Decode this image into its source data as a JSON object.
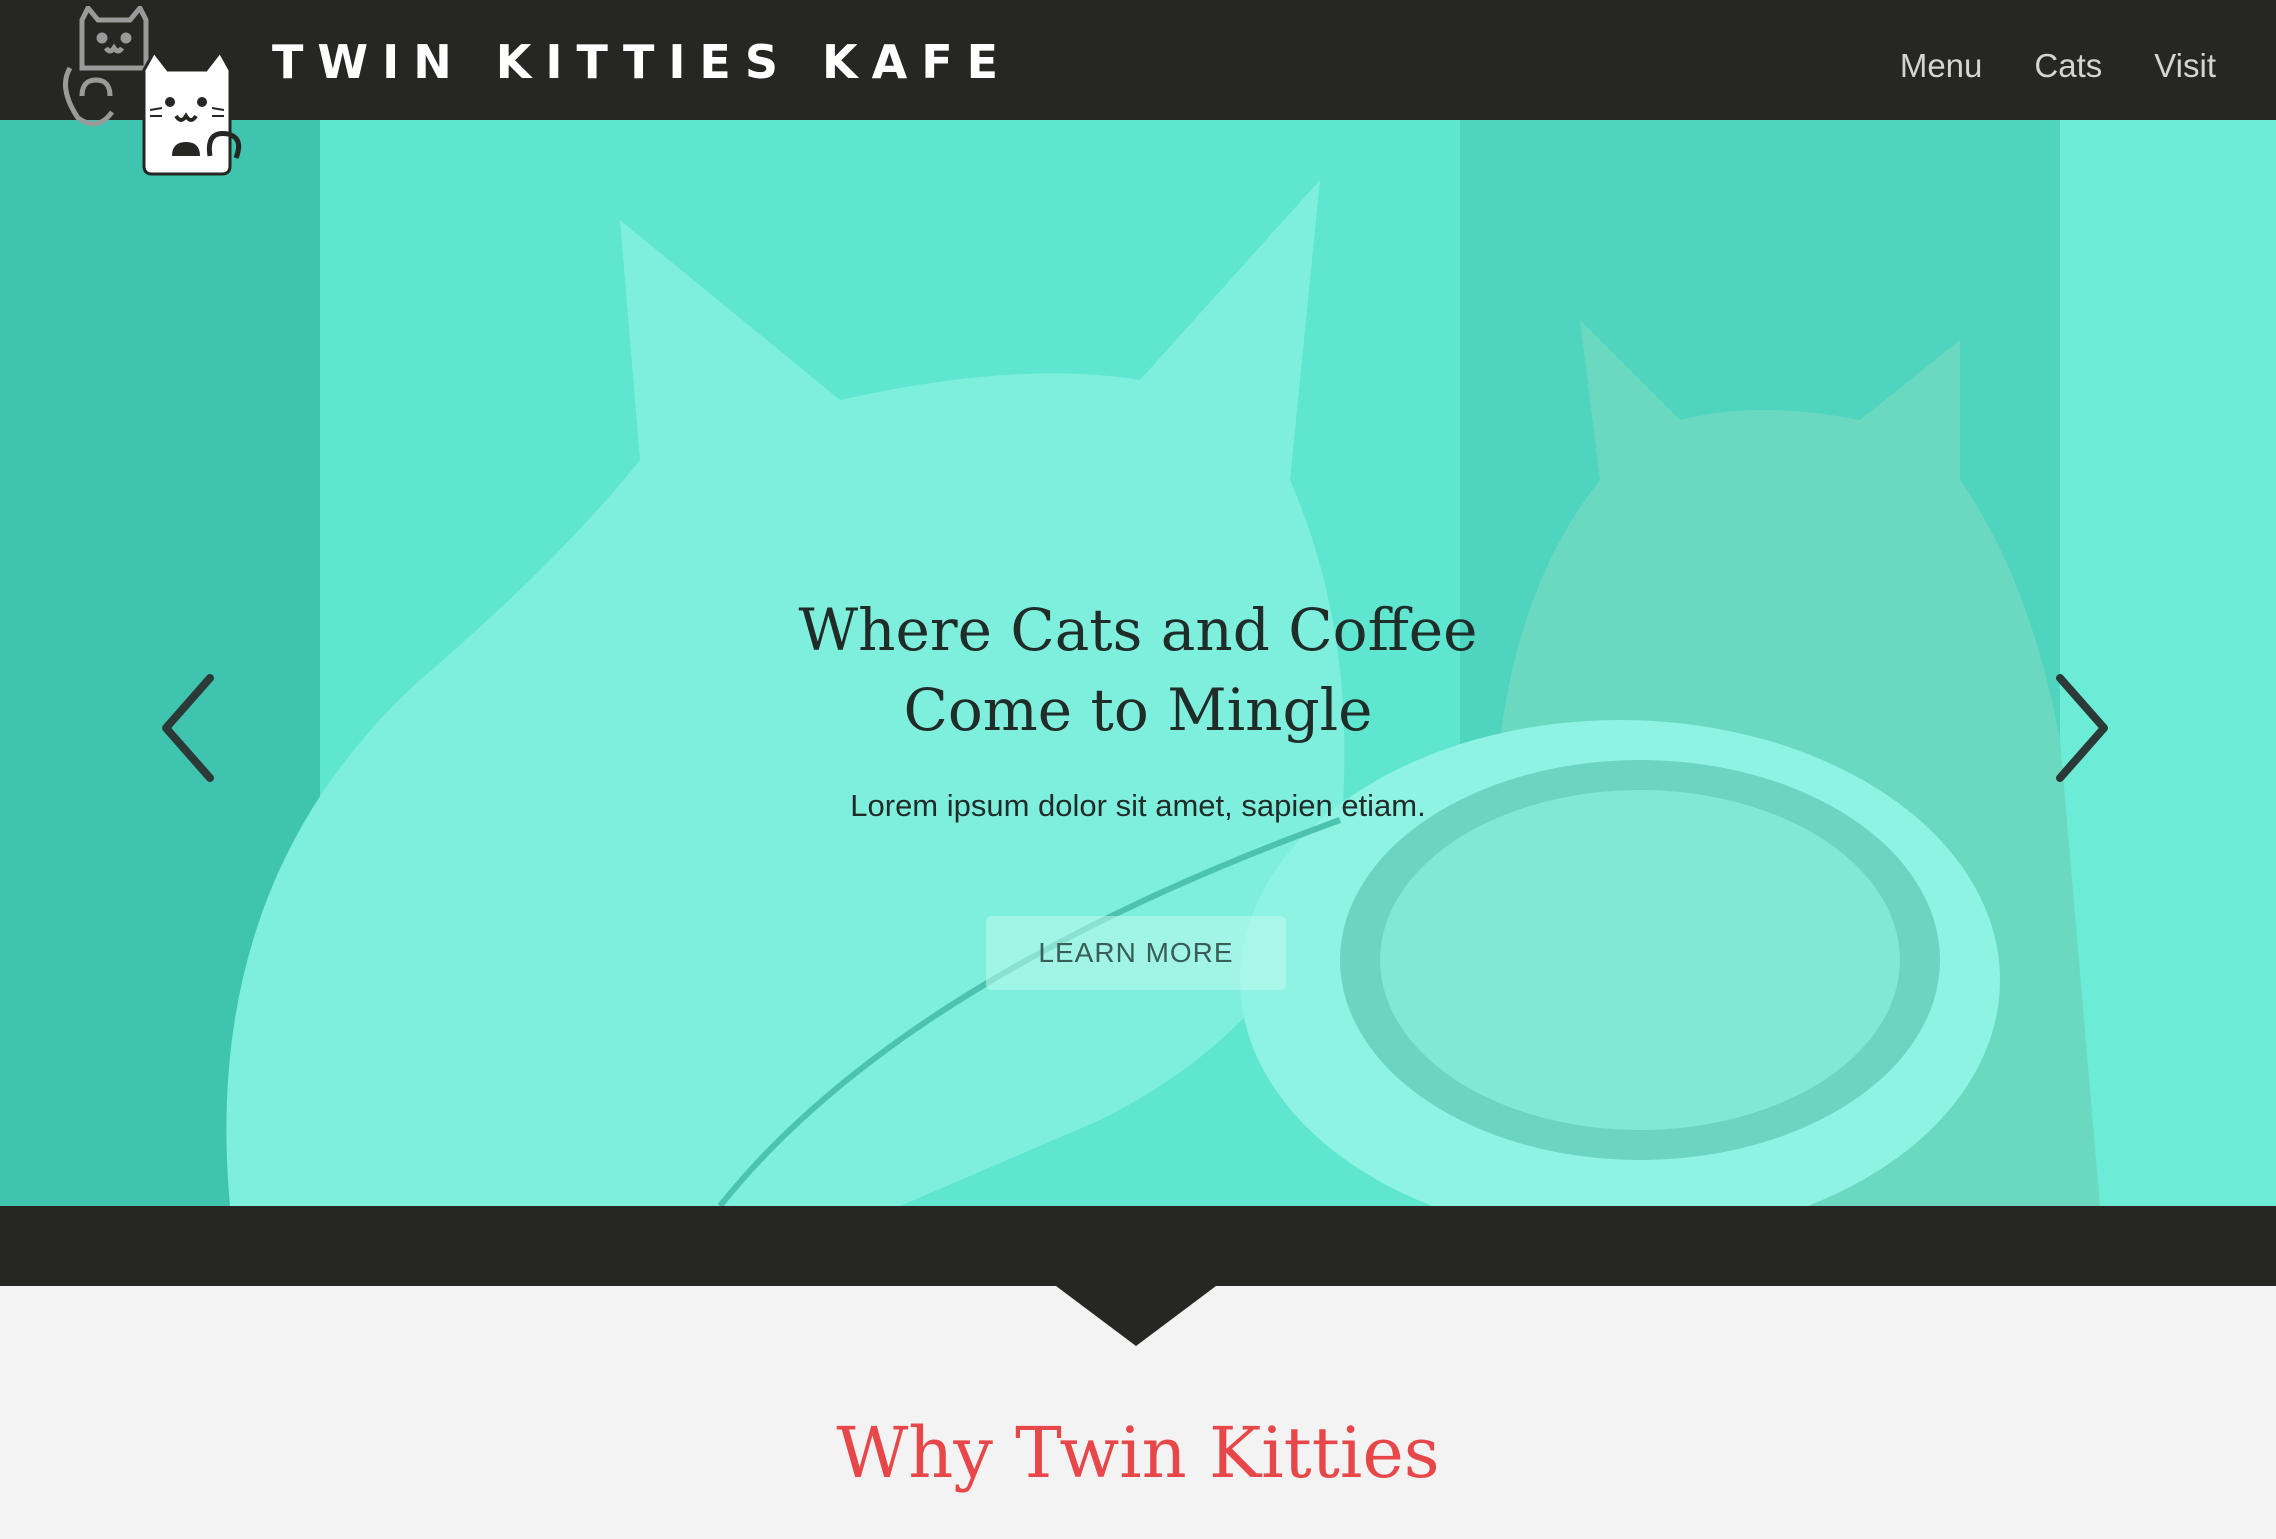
{
  "colors": {
    "nav_bg": "#262622",
    "hero_tint": "#5ee6d0",
    "accent_red": "#e8474a",
    "page_bg": "#f3f3f3"
  },
  "header": {
    "logo_icon": "twin-cats-logo",
    "brand": "TWIN KITTIES KAFE",
    "nav": [
      {
        "label": "Menu"
      },
      {
        "label": "Cats"
      },
      {
        "label": "Visit"
      }
    ]
  },
  "hero": {
    "title_line1": "Where Cats and Coffee",
    "title_line2": "Come to Mingle",
    "subtitle": "Lorem ipsum dolor sit amet, sapien etiam.",
    "button": "LEARN MORE",
    "prev_icon": "chevron-left-icon",
    "next_icon": "chevron-right-icon"
  },
  "section": {
    "title": "Why Twin Kitties"
  }
}
